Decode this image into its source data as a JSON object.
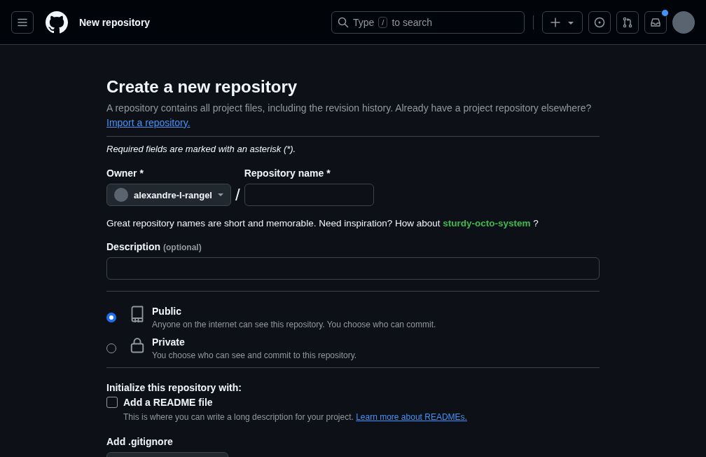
{
  "header": {
    "title": "New repository",
    "search": {
      "before": "Type",
      "key": "/",
      "after": "to search"
    },
    "inbox_unread": true
  },
  "page": {
    "title": "Create a new repository",
    "intro": "A repository contains all project files, including the revision history. Already have a project repository elsewhere?",
    "import_link": "Import a repository.",
    "required_note": "Required fields are marked with an asterisk (*).",
    "owner": {
      "label": "Owner *",
      "value": "alexandre-l-rangel"
    },
    "separator": "/",
    "repo_name": {
      "label": "Repository name *"
    },
    "hint": {
      "text": "Great repository names are short and memorable. Need inspiration? How about",
      "suggestion": "sturdy-octo-system",
      "end": "?"
    },
    "description": {
      "label": "Description",
      "optional": "(optional)"
    },
    "visibility": [
      {
        "kind": "public",
        "label": "Public",
        "detail": "Anyone on the internet can see this repository. You choose who can commit.",
        "selected": true
      },
      {
        "kind": "private",
        "label": "Private",
        "detail": "You choose who can see and commit to this repository.",
        "selected": false
      }
    ],
    "init": {
      "title": "Initialize this repository with:",
      "readme": {
        "label": "Add a README file",
        "checked": false,
        "detail": "This is where you can write a long description for your project.",
        "link": "Learn more about READMEs."
      }
    },
    "gitignore": {
      "label": "Add .gitignore"
    }
  }
}
